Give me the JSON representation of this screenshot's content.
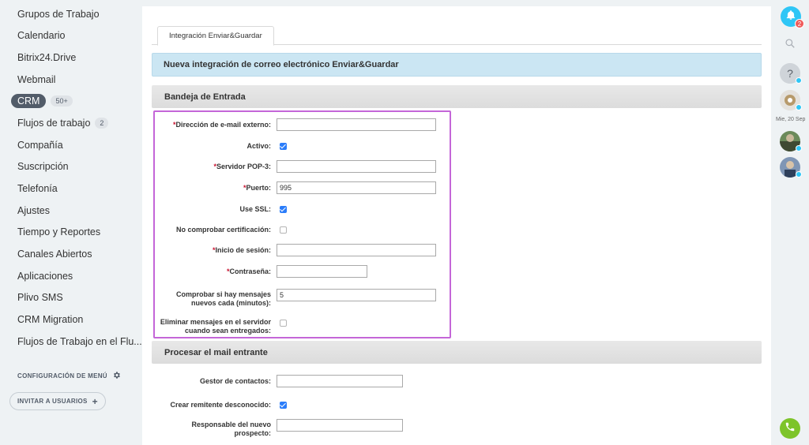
{
  "sidebar": {
    "items": [
      {
        "label": "Grupos de Trabajo"
      },
      {
        "label": "Calendario"
      },
      {
        "label": "Bitrix24.Drive"
      },
      {
        "label": "Webmail"
      },
      {
        "label": "CRM",
        "badge": "50+"
      },
      {
        "label": "Flujos de trabajo",
        "badge": "2"
      },
      {
        "label": "Compañía"
      },
      {
        "label": "Suscripción"
      },
      {
        "label": "Telefonía"
      },
      {
        "label": "Ajustes"
      },
      {
        "label": "Tiempo y Reportes"
      },
      {
        "label": "Canales Abiertos"
      },
      {
        "label": "Aplicaciones"
      },
      {
        "label": "Plivo SMS"
      },
      {
        "label": "CRM Migration"
      },
      {
        "label": "Flujos de Trabajo en el Flu..."
      }
    ],
    "menu_config_label": "CONFIGURACIÓN DE MENÚ",
    "invite_label": "INVITAR A USUARIOS"
  },
  "tab": {
    "label": "Integración Enviar&Guardar"
  },
  "header": {
    "title": "Nueva integración de correo electrónico Enviar&Guardar"
  },
  "inbox": {
    "title": "Bandeja de Entrada",
    "fields": {
      "email": {
        "required": "*",
        "label": "Dirección de e-mail externo:",
        "value": ""
      },
      "active": {
        "label": "Activo:",
        "checked": true
      },
      "pop3": {
        "required": "*",
        "label": "Servidor POP-3:",
        "value": ""
      },
      "port": {
        "required": "*",
        "label": "Puerto:",
        "value": "995"
      },
      "ssl": {
        "label": "Use SSL:",
        "checked": true
      },
      "nocert": {
        "label": "No comprobar certificación:",
        "checked": false
      },
      "login": {
        "required": "*",
        "label": "Inicio de sesión:",
        "value": ""
      },
      "password": {
        "required": "*",
        "label": "Contraseña:",
        "value": ""
      },
      "interval": {
        "label_line1": "Comprobar si hay mensajes",
        "label_line2": "nuevos cada (minutos):",
        "value": "5"
      },
      "delete": {
        "label_line1": "Eliminar mensajes en el servidor",
        "label_line2": "cuando sean entregados:",
        "checked": false
      }
    }
  },
  "incoming": {
    "title": "Procesar el mail entrante",
    "fields": {
      "contacts": {
        "label": "Gestor de contactos:",
        "value": ""
      },
      "create_sender": {
        "label": "Crear remitente desconocido:",
        "checked": true
      },
      "responsible": {
        "label_line1": "Responsable del nuevo",
        "label_line2": "prospecto:",
        "value": ""
      }
    }
  },
  "rightbar": {
    "notification_count": "2",
    "date_label": "Mie, 20 Sep"
  },
  "colors": {
    "accent": "#2fc6f6",
    "highlight": "#c466d8",
    "checkbox": "#2b7dfa",
    "phone": "#7dc42a"
  }
}
